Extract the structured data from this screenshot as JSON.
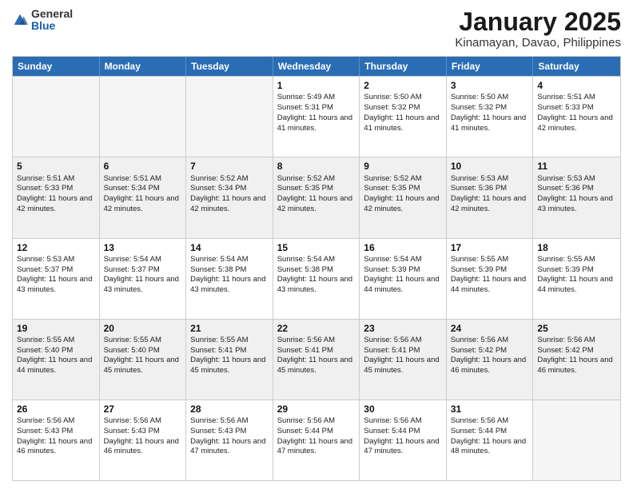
{
  "logo": {
    "general": "General",
    "blue": "Blue"
  },
  "title": "January 2025",
  "subtitle": "Kinamayan, Davao, Philippines",
  "days": [
    "Sunday",
    "Monday",
    "Tuesday",
    "Wednesday",
    "Thursday",
    "Friday",
    "Saturday"
  ],
  "weeks": [
    [
      {
        "day": "",
        "empty": true
      },
      {
        "day": "",
        "empty": true
      },
      {
        "day": "",
        "empty": true
      },
      {
        "day": "1",
        "sunrise": "5:49 AM",
        "sunset": "5:31 PM",
        "daylight": "11 hours and 41 minutes."
      },
      {
        "day": "2",
        "sunrise": "5:50 AM",
        "sunset": "5:32 PM",
        "daylight": "11 hours and 41 minutes."
      },
      {
        "day": "3",
        "sunrise": "5:50 AM",
        "sunset": "5:32 PM",
        "daylight": "11 hours and 41 minutes."
      },
      {
        "day": "4",
        "sunrise": "5:51 AM",
        "sunset": "5:33 PM",
        "daylight": "11 hours and 42 minutes."
      }
    ],
    [
      {
        "day": "5",
        "sunrise": "5:51 AM",
        "sunset": "5:33 PM",
        "daylight": "11 hours and 42 minutes."
      },
      {
        "day": "6",
        "sunrise": "5:51 AM",
        "sunset": "5:34 PM",
        "daylight": "11 hours and 42 minutes."
      },
      {
        "day": "7",
        "sunrise": "5:52 AM",
        "sunset": "5:34 PM",
        "daylight": "11 hours and 42 minutes."
      },
      {
        "day": "8",
        "sunrise": "5:52 AM",
        "sunset": "5:35 PM",
        "daylight": "11 hours and 42 minutes."
      },
      {
        "day": "9",
        "sunrise": "5:52 AM",
        "sunset": "5:35 PM",
        "daylight": "11 hours and 42 minutes."
      },
      {
        "day": "10",
        "sunrise": "5:53 AM",
        "sunset": "5:36 PM",
        "daylight": "11 hours and 42 minutes."
      },
      {
        "day": "11",
        "sunrise": "5:53 AM",
        "sunset": "5:36 PM",
        "daylight": "11 hours and 43 minutes."
      }
    ],
    [
      {
        "day": "12",
        "sunrise": "5:53 AM",
        "sunset": "5:37 PM",
        "daylight": "11 hours and 43 minutes."
      },
      {
        "day": "13",
        "sunrise": "5:54 AM",
        "sunset": "5:37 PM",
        "daylight": "11 hours and 43 minutes."
      },
      {
        "day": "14",
        "sunrise": "5:54 AM",
        "sunset": "5:38 PM",
        "daylight": "11 hours and 43 minutes."
      },
      {
        "day": "15",
        "sunrise": "5:54 AM",
        "sunset": "5:38 PM",
        "daylight": "11 hours and 43 minutes."
      },
      {
        "day": "16",
        "sunrise": "5:54 AM",
        "sunset": "5:39 PM",
        "daylight": "11 hours and 44 minutes."
      },
      {
        "day": "17",
        "sunrise": "5:55 AM",
        "sunset": "5:39 PM",
        "daylight": "11 hours and 44 minutes."
      },
      {
        "day": "18",
        "sunrise": "5:55 AM",
        "sunset": "5:39 PM",
        "daylight": "11 hours and 44 minutes."
      }
    ],
    [
      {
        "day": "19",
        "sunrise": "5:55 AM",
        "sunset": "5:40 PM",
        "daylight": "11 hours and 44 minutes."
      },
      {
        "day": "20",
        "sunrise": "5:55 AM",
        "sunset": "5:40 PM",
        "daylight": "11 hours and 45 minutes."
      },
      {
        "day": "21",
        "sunrise": "5:55 AM",
        "sunset": "5:41 PM",
        "daylight": "11 hours and 45 minutes."
      },
      {
        "day": "22",
        "sunrise": "5:56 AM",
        "sunset": "5:41 PM",
        "daylight": "11 hours and 45 minutes."
      },
      {
        "day": "23",
        "sunrise": "5:56 AM",
        "sunset": "5:41 PM",
        "daylight": "11 hours and 45 minutes."
      },
      {
        "day": "24",
        "sunrise": "5:56 AM",
        "sunset": "5:42 PM",
        "daylight": "11 hours and 46 minutes."
      },
      {
        "day": "25",
        "sunrise": "5:56 AM",
        "sunset": "5:42 PM",
        "daylight": "11 hours and 46 minutes."
      }
    ],
    [
      {
        "day": "26",
        "sunrise": "5:56 AM",
        "sunset": "5:43 PM",
        "daylight": "11 hours and 46 minutes."
      },
      {
        "day": "27",
        "sunrise": "5:56 AM",
        "sunset": "5:43 PM",
        "daylight": "11 hours and 46 minutes."
      },
      {
        "day": "28",
        "sunrise": "5:56 AM",
        "sunset": "5:43 PM",
        "daylight": "11 hours and 47 minutes."
      },
      {
        "day": "29",
        "sunrise": "5:56 AM",
        "sunset": "5:44 PM",
        "daylight": "11 hours and 47 minutes."
      },
      {
        "day": "30",
        "sunrise": "5:56 AM",
        "sunset": "5:44 PM",
        "daylight": "11 hours and 47 minutes."
      },
      {
        "day": "31",
        "sunrise": "5:56 AM",
        "sunset": "5:44 PM",
        "daylight": "11 hours and 48 minutes."
      },
      {
        "day": "",
        "empty": true
      }
    ]
  ]
}
